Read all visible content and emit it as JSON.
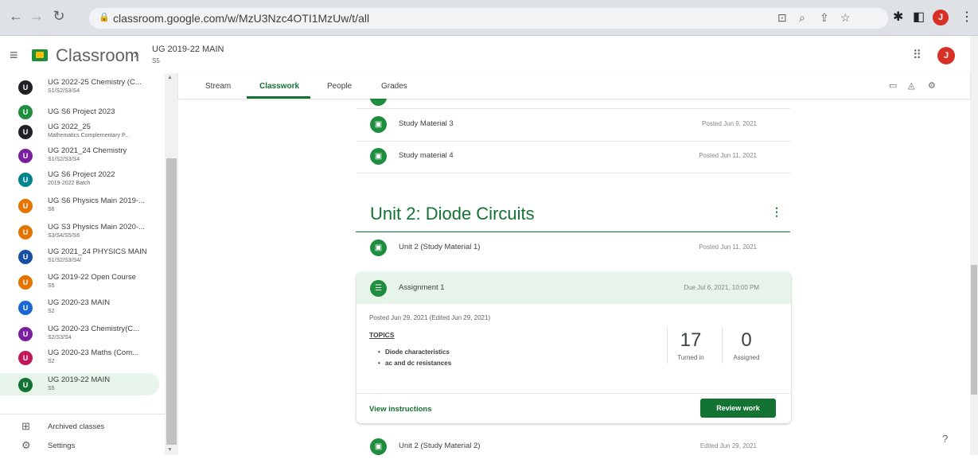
{
  "browser": {
    "url": "classroom.google.com/w/MzU3Nzc4OTI1MzUw/t/all",
    "profile_initial": "J"
  },
  "header": {
    "app_title": "Classroom",
    "crumb_title": "UG 2019-22 MAIN",
    "crumb_sub": "S5",
    "avatar_initial": "J"
  },
  "sidebar": {
    "classes": [
      {
        "initial": "U",
        "name": "UG 2022-25 Chemistry (C...",
        "sub": "S1/S2/S3/S4",
        "color": "#202124"
      },
      {
        "initial": "U",
        "name": "UG S6 Project 2023",
        "sub": "",
        "color": "#1e8e3e"
      },
      {
        "initial": "U",
        "name": "UG 2022_25",
        "sub": "Mathematics Complementary P...",
        "color": "#202124"
      },
      {
        "initial": "U",
        "name": "UG 2021_24 Chemistry",
        "sub": "S1/S2/S3/S4",
        "color": "#7b1fa2"
      },
      {
        "initial": "U",
        "name": "UG S6 Project 2022",
        "sub": "2019-2022 Batch",
        "color": "#00838f"
      },
      {
        "initial": "U",
        "name": "UG S6 Physics Main 2019-...",
        "sub": "S6",
        "color": "#e37400"
      },
      {
        "initial": "U",
        "name": "UG S3 Physics Main 2020-...",
        "sub": "S3/S4/S5/S6",
        "color": "#e37400"
      },
      {
        "initial": "U",
        "name": "UG 2021_24 PHYSICS MAIN",
        "sub": "S1/S2/S3/S4/",
        "color": "#174ea6"
      },
      {
        "initial": "U",
        "name": "UG 2019-22 Open Course",
        "sub": "S5",
        "color": "#e37400"
      },
      {
        "initial": "U",
        "name": "UG 2020-23 MAIN",
        "sub": "S2",
        "color": "#1967d2"
      },
      {
        "initial": "U",
        "name": "UG 2020-23 Chemistry(C...",
        "sub": "S2/S3/S4",
        "color": "#7b1fa2"
      },
      {
        "initial": "U",
        "name": "UG 2020-23 Maths (Com...",
        "sub": "S2",
        "color": "#c2185b"
      },
      {
        "initial": "U",
        "name": "UG 2019-22 MAIN",
        "sub": "S5",
        "color": "#137333"
      }
    ],
    "archived_label": "Archived classes",
    "settings_label": "Settings"
  },
  "tabs": {
    "stream": "Stream",
    "classwork": "Classwork",
    "people": "People",
    "grades": "Grades"
  },
  "classwork": {
    "items_top": [
      {
        "title": "Study Material 3",
        "date": "Posted Jun 9, 2021"
      },
      {
        "title": "Study material 4",
        "date": "Posted Jun 11, 2021"
      }
    ],
    "unit_title": "Unit 2: Diode Circuits",
    "unit_item": {
      "title": "Unit 2 (Study Material 1)",
      "date": "Posted Jun 11, 2021"
    },
    "assignment": {
      "title": "Assignment 1",
      "due": "Due Jul 6, 2021, 10:00 PM",
      "posted": "Posted Jun 29, 2021 (Edited Jun 29, 2021)",
      "topics_label": "TOPICS",
      "bullets": [
        "Diode characteristics",
        "ac and dc resistances"
      ],
      "turned_in_count": "17",
      "turned_in_label": "Turned in",
      "assigned_count": "0",
      "assigned_label": "Assigned",
      "view_instructions": "View instructions",
      "review_work": "Review work"
    },
    "last_item": {
      "title": "Unit 2 (Study Material 2)",
      "date": "Edited Jun 29, 2021"
    }
  },
  "colors": {
    "accent": "#137333",
    "accent_light": "#e6f4ea",
    "icon_green": "#1e8e3e"
  }
}
